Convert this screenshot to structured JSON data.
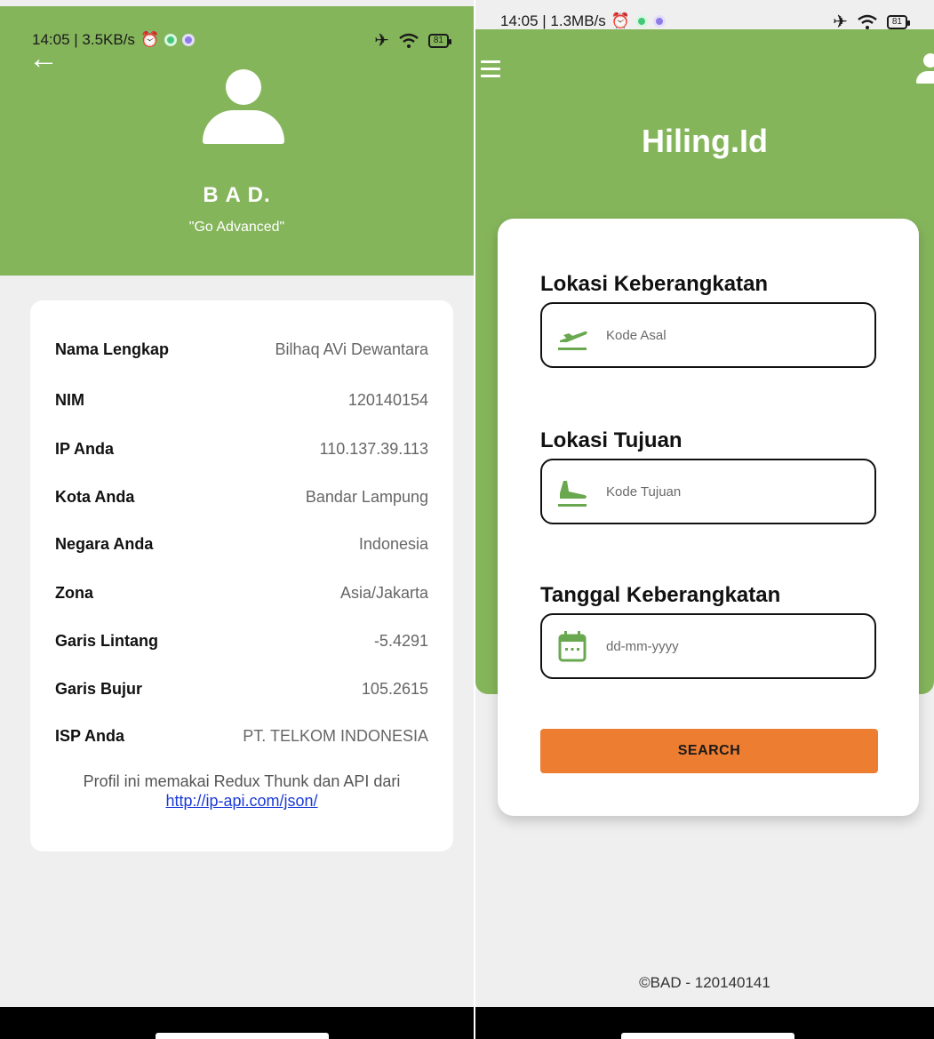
{
  "left": {
    "status_bar": {
      "time": "14:05 | 3.5KB/s",
      "battery": "81"
    },
    "profile": {
      "name": "B A D.",
      "motto": "\"Go Advanced\""
    },
    "info_rows": [
      {
        "label": "Nama Lengkap",
        "value": "Bilhaq AVi Dewantara"
      },
      {
        "label": "NIM",
        "value": "120140154"
      },
      {
        "label": "IP Anda",
        "value": "110.137.39.113"
      },
      {
        "label": "Kota Anda",
        "value": "Bandar Lampung"
      },
      {
        "label": "Negara Anda",
        "value": "Indonesia"
      },
      {
        "label": "Zona",
        "value": "Asia/Jakarta"
      },
      {
        "label": "Garis Lintang",
        "value": "-5.4291"
      },
      {
        "label": "Garis Bujur",
        "value": "105.2615"
      },
      {
        "label": "ISP Anda",
        "value": "PT. TELKOM INDONESIA"
      }
    ],
    "footnote": {
      "text": "Profil ini memakai Redux Thunk dan API dari",
      "link": "http://ip-api.com/json/"
    }
  },
  "right": {
    "status_bar": {
      "time": "14:05 | 1.3MB/s",
      "battery": "81"
    },
    "app_title": "Hiling.Id",
    "form": {
      "departure_label": "Lokasi Keberangkatan",
      "departure_placeholder": "Kode Asal",
      "destination_label": "Lokasi Tujuan",
      "destination_placeholder": "Kode Tujuan",
      "date_label": "Tanggal Keberangkatan",
      "date_placeholder": "dd-mm-yyyy",
      "search_label": "SEARCH"
    },
    "copyright": "©BAD - 120140141"
  },
  "colors": {
    "brand_green": "#85b55b",
    "search_orange": "#ed7d31",
    "link_blue": "#1a3ad6",
    "icon_green": "#6aa84f"
  },
  "icons": [
    "back-arrow-icon",
    "avatar-icon",
    "menu-icon",
    "user-icon",
    "plane-takeoff-icon",
    "plane-landing-icon",
    "calendar-icon",
    "wifi-icon",
    "airplane-mode-icon",
    "alarm-icon",
    "battery-icon"
  ]
}
